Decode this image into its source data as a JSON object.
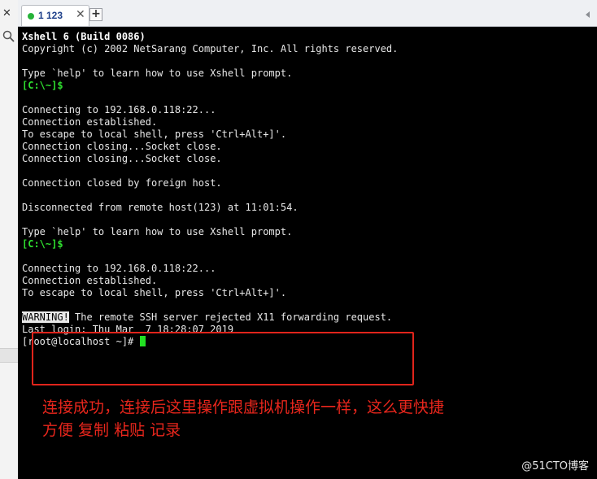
{
  "tab": {
    "label": "1 123",
    "add_label": "+",
    "close_glyph": "✕",
    "status_color": "#27b33a"
  },
  "sidebar": {
    "close_glyph": "✕"
  },
  "terminal": {
    "lines": [
      {
        "text": "Xshell 6 (Build 0086)",
        "style": "bold"
      },
      {
        "text": "Copyright (c) 2002 NetSarang Computer, Inc. All rights reserved."
      },
      {
        "text": ""
      },
      {
        "text": "Type `help' to learn how to use Xshell prompt."
      },
      {
        "text": "[C:\\~]$",
        "style": "prompt"
      },
      {
        "text": ""
      },
      {
        "text": "Connecting to 192.168.0.118:22..."
      },
      {
        "text": "Connection established."
      },
      {
        "text": "To escape to local shell, press 'Ctrl+Alt+]'."
      },
      {
        "text": "Connection closing...Socket close."
      },
      {
        "text": "Connection closing...Socket close."
      },
      {
        "text": ""
      },
      {
        "text": "Connection closed by foreign host."
      },
      {
        "text": ""
      },
      {
        "text": "Disconnected from remote host(123) at 11:01:54."
      },
      {
        "text": ""
      },
      {
        "text": "Type `help' to learn how to use Xshell prompt."
      },
      {
        "text": "[C:\\~]$",
        "style": "prompt"
      },
      {
        "text": ""
      },
      {
        "text": "Connecting to 192.168.0.118:22..."
      },
      {
        "text": "Connection established."
      },
      {
        "text": "To escape to local shell, press 'Ctrl+Alt+]'."
      },
      {
        "text": ""
      },
      {
        "text": " The remote SSH server rejected X11 forwarding request.",
        "highlight": "WARNING!"
      },
      {
        "text": "Last login: Thu Mar  7 18:28:07 2019"
      },
      {
        "text": "[root@localhost ~]# ",
        "cursor": true
      }
    ]
  },
  "annotation": {
    "line1": "连接成功，连接后这里操作跟虚拟机操作一样，这么更快捷",
    "line2": "方便 复制 粘贴 记录",
    "color": "#e8261c"
  },
  "watermark": "@51CTO博客"
}
